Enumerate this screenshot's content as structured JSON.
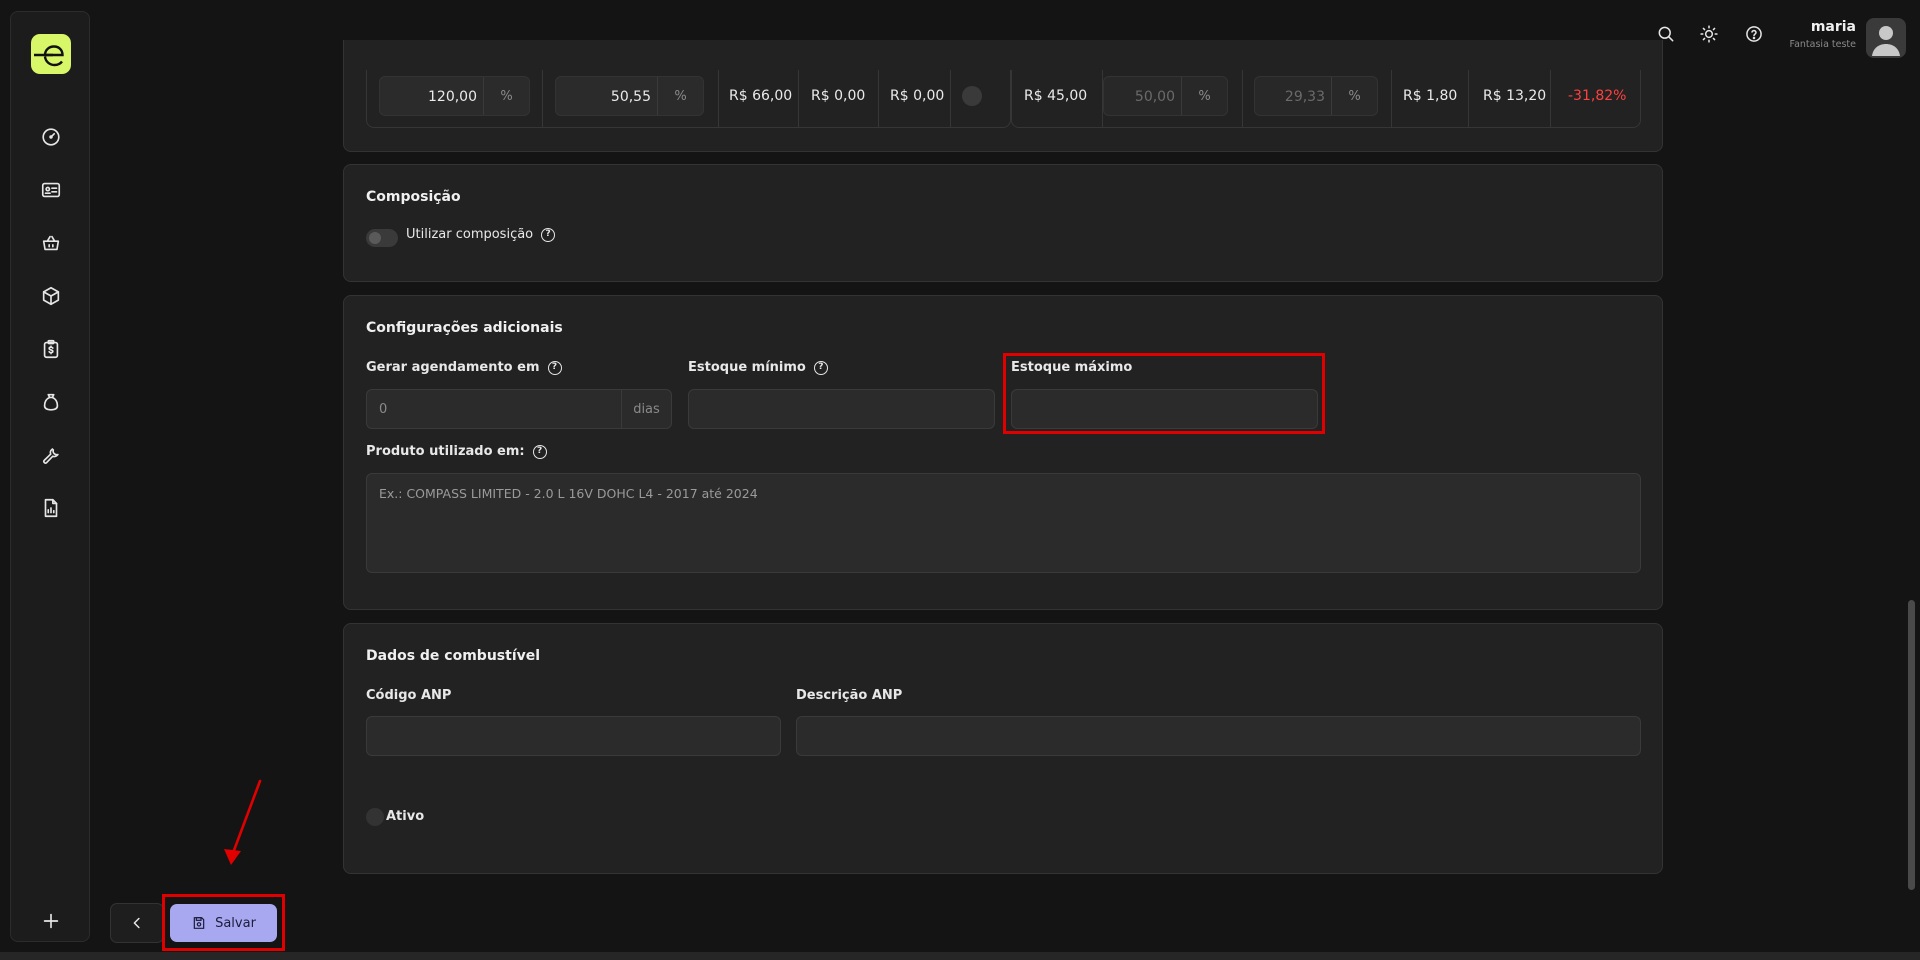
{
  "user": {
    "name": "maria",
    "company": "Fantasia teste"
  },
  "price_table": {
    "markup_value": "120,00",
    "markup_suffix": "%",
    "margin_value": "50,55",
    "margin_suffix": "%",
    "price": "R$ 66,00",
    "cost_a": "R$ 0,00",
    "cost_b": "R$ 0,00",
    "promo_price": "R$ 45,00",
    "promo_markup": "50,00",
    "promo_markup_suffix": "%",
    "promo_margin": "29,33",
    "promo_margin_suffix": "%",
    "promo_cost_a": "R$ 1,80",
    "promo_cost_b": "R$ 13,20",
    "variation": "-31,82%"
  },
  "composicao": {
    "title": "Composição",
    "toggle_label": "Utilizar composição"
  },
  "config": {
    "title": "Configurações adicionais",
    "agendamento_label": "Gerar agendamento em",
    "agendamento_value": "0",
    "agendamento_suffix": "dias",
    "estoque_min_label": "Estoque mínimo",
    "estoque_max_label": "Estoque máximo",
    "produto_label": "Produto utilizado em:",
    "produto_placeholder": "Ex.: COMPASS LIMITED - 2.0 L 16V DOHC L4 - 2017 até 2024"
  },
  "combustivel": {
    "title": "Dados de combustível",
    "codigo_label": "Código ANP",
    "descricao_label": "Descrição ANP",
    "ativo_label": "Ativo"
  },
  "actions": {
    "save_label": "Salvar"
  },
  "colors": {
    "accent": "#d8f768",
    "save": "#a8a8f0",
    "highlight": "#e00000",
    "negative": "#ff4040"
  }
}
